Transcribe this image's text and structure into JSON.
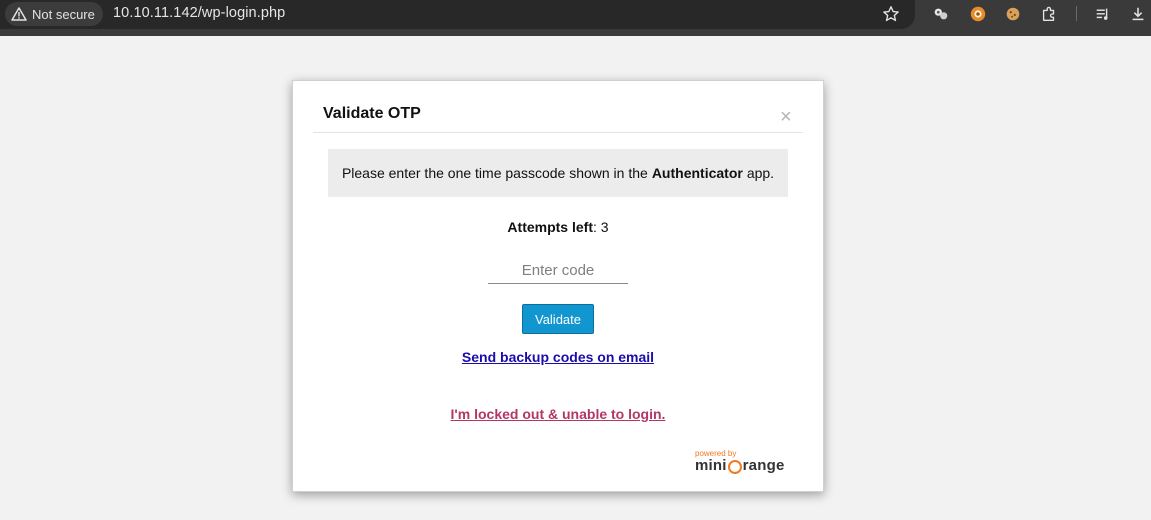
{
  "browser": {
    "security_label": "Not secure",
    "url": "10.10.11.142/wp-login.php",
    "icons": [
      "warning-icon",
      "bookmark-star-icon",
      "extension-icon-1",
      "extension-icon-2",
      "cookie-icon",
      "puzzle-icon",
      "media-icon",
      "download-icon"
    ]
  },
  "modal": {
    "title": "Validate OTP",
    "close_label": "×",
    "notice": {
      "prefix": "Please enter the one time passcode shown in the",
      "app_name": "Authenticator",
      "suffix": "app."
    },
    "attempts": {
      "label": "Attempts left",
      "separator": ": ",
      "value": "3"
    },
    "code_input": {
      "placeholder": "Enter code",
      "value": ""
    },
    "validate_label": "Validate",
    "backup_link": "Send backup codes on email",
    "locked_link": "I'm locked out & unable to login.",
    "branding": {
      "powered_by": "powered by",
      "logo_prefix": "mini",
      "logo_suffix": "range"
    }
  },
  "colors": {
    "accent": "#1296d0",
    "link": "#1a0dab",
    "locked_link": "#b33766",
    "brand_orange": "#f17a22"
  }
}
